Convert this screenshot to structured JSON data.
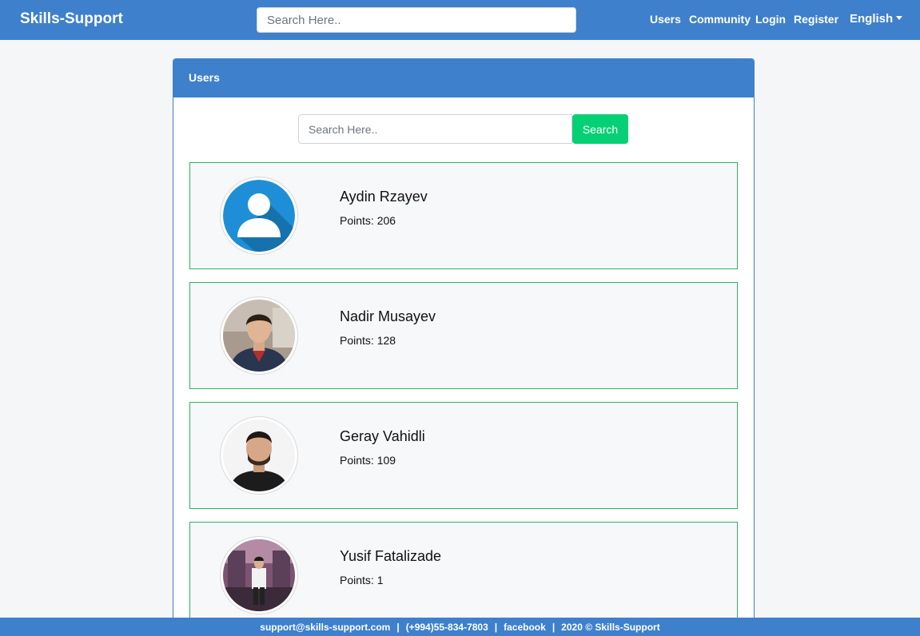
{
  "navbar": {
    "brand": "Skills-Support",
    "search_placeholder": "Search Here..",
    "links": [
      "Users",
      "Community",
      "Login",
      "Register"
    ],
    "language": "English"
  },
  "card": {
    "header": "Users",
    "search_placeholder": "Search Here..",
    "search_button": "Search"
  },
  "users": [
    {
      "name": "Aydin Rzayev",
      "points": "Points: 206",
      "avatar": "default-user-icon"
    },
    {
      "name": "Nadir Musayev",
      "points": "Points: 128",
      "avatar": "profile-photo"
    },
    {
      "name": "Geray Vahidli",
      "points": "Points: 109",
      "avatar": "profile-photo"
    },
    {
      "name": "Yusif Fatalizade",
      "points": "Points: 1",
      "avatar": "profile-photo"
    }
  ],
  "footer": {
    "email": "support@skills-support.com",
    "phone": "(+994)55-834-7803",
    "facebook": "facebook",
    "copyright": "2020 © Skills-Support"
  },
  "colors": {
    "primary": "#3e80cc",
    "success": "#05d075",
    "card_border": "#28b463",
    "background": "#f5f6f8"
  }
}
